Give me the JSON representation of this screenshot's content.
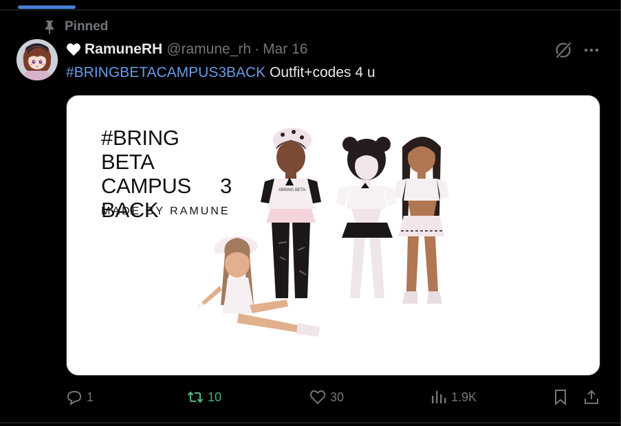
{
  "pinned_label": "Pinned",
  "author": {
    "display_name": "RamuneRH",
    "handle": "@ramune_rh",
    "date": "Mar 16"
  },
  "tweet": {
    "hashtag": "#BRINGBETACAMPUS3BACK",
    "text": " Outfit+codes 4 u"
  },
  "media": {
    "title_line1": "#BRING BETA",
    "title_line2_a": "CAMPUS",
    "title_line2_b": "3",
    "title_line3": "BACK",
    "subtitle": "MADE BY RAMUNE",
    "shirt_text_a": "#BRING BETA",
    "shirt_text_b": "CAMPUS 3 BACK"
  },
  "actions": {
    "replies": "1",
    "retweets": "10",
    "likes": "30",
    "views": "1.9K"
  },
  "icons": {
    "pin": "pin-icon",
    "heart": "heart-icon",
    "grok": "grok-icon",
    "more": "more-icon",
    "reply": "reply-icon",
    "retweet": "retweet-icon",
    "like": "like-icon",
    "views": "views-icon",
    "bookmark": "bookmark-icon",
    "share": "share-icon"
  },
  "colors": {
    "background": "#000000",
    "text": "#e7e9ea",
    "secondary": "#71767b",
    "hashtag": "#6b9be8",
    "retweet_active": "#4cb07a",
    "tab_indicator": "#4a7fd8"
  }
}
